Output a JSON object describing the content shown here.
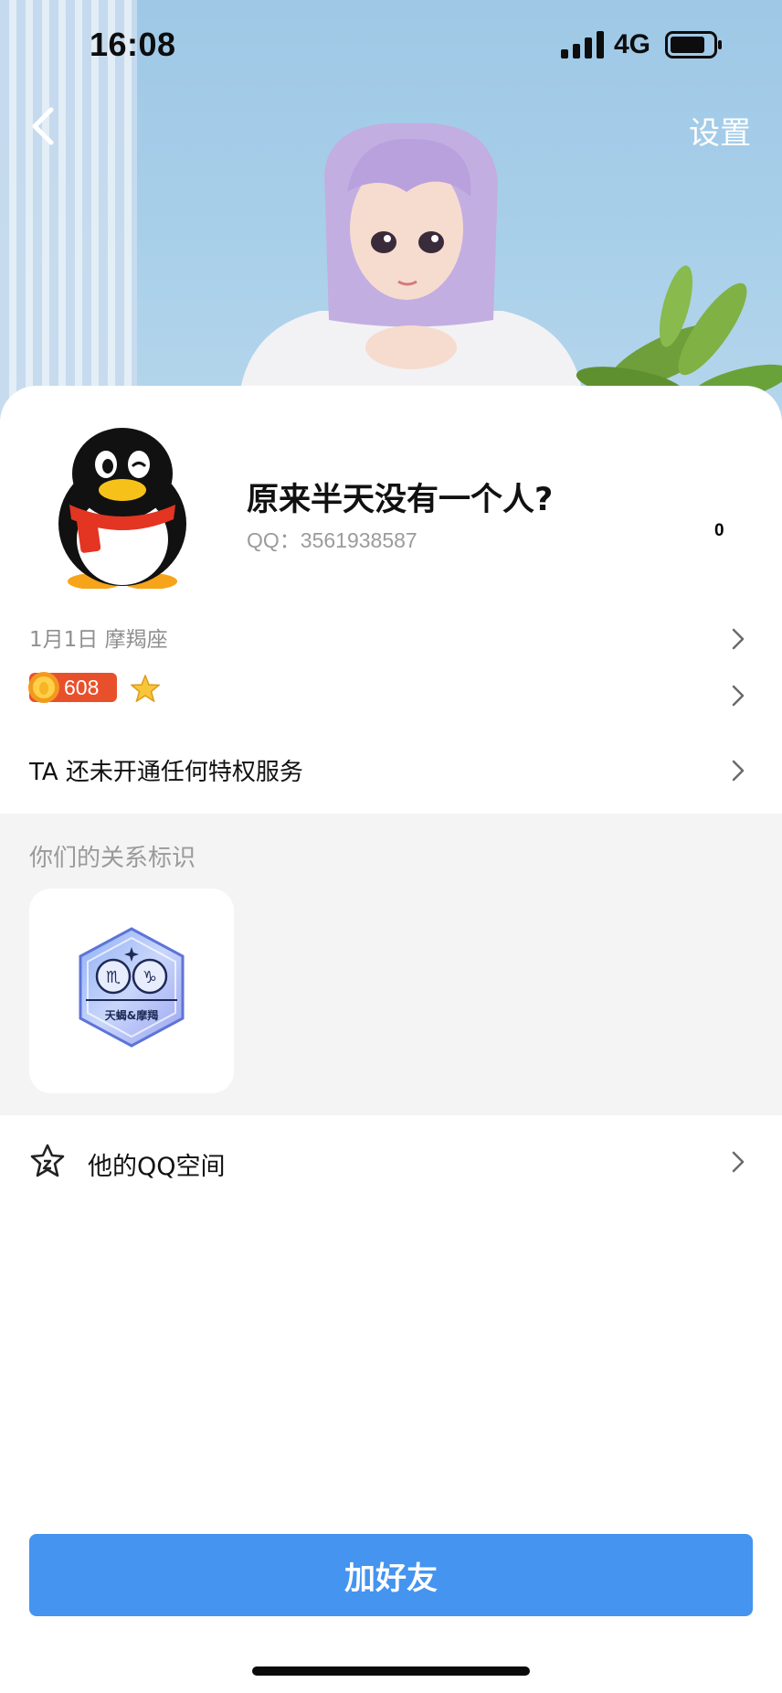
{
  "status_bar": {
    "time": "16:08",
    "network": "4G",
    "icons": [
      "signal-icon",
      "battery-icon"
    ]
  },
  "header": {
    "back_icon": "chevron-left-icon",
    "settings_label": "设置"
  },
  "profile": {
    "nickname": "原来半天没有一个人?",
    "qq_number": "QQ：3561938587",
    "like_count": "0",
    "avatar_icon": "qq-penguin-icon"
  },
  "info": {
    "birthday": "1月1日 摩羯座",
    "level_value": "608",
    "level_icons": [
      "sun-coin-icon",
      "star-icon"
    ],
    "privilege_text": "TA 还未开通任何特权服务"
  },
  "relation": {
    "title": "你们的关系标识",
    "badge_label": "天蝎&摩羯",
    "badge_icon": "zodiac-scorpio-capricorn-badge"
  },
  "qzone": {
    "label": "他的QQ空间",
    "icon": "qzone-star-icon"
  },
  "actions": {
    "add_friend": "加好友"
  },
  "colors": {
    "primary_button": "#4494f0",
    "level_badge": "#e8502c",
    "section_bg": "#f4f4f4",
    "hero_bg": "#a8cfe9"
  }
}
